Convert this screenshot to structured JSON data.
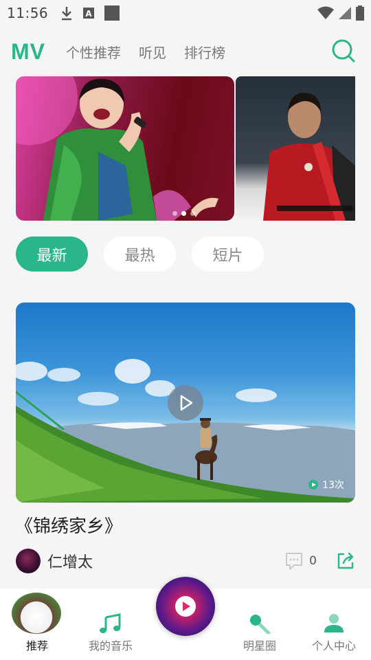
{
  "status_bar": {
    "time": "11:56",
    "icons": [
      "download-icon",
      "a-icon",
      "square-icon",
      "wifi-icon",
      "signal-icon",
      "battery-icon"
    ]
  },
  "header": {
    "brand": "MV",
    "tabs": [
      {
        "label": "个性推荐"
      },
      {
        "label": "听见"
      },
      {
        "label": "排行榜"
      }
    ],
    "search_icon": "search-icon"
  },
  "banner": {
    "slide_count": 3,
    "active_slide": 1
  },
  "filters": [
    {
      "label": "最新",
      "active": true
    },
    {
      "label": "最热",
      "active": false
    },
    {
      "label": "短片",
      "active": false
    }
  ],
  "video": {
    "views": "13次",
    "title": "《锦绣家乡》",
    "author": "仁增太",
    "comment_count": "0"
  },
  "bottom_nav": [
    {
      "label": "推荐",
      "active": true
    },
    {
      "label": "我的音乐",
      "active": false
    },
    {
      "label": "明星圈",
      "active": false
    },
    {
      "label": "个人中心",
      "active": false
    }
  ],
  "colors": {
    "accent": "#2bb58a",
    "background": "#f5f5f5"
  }
}
